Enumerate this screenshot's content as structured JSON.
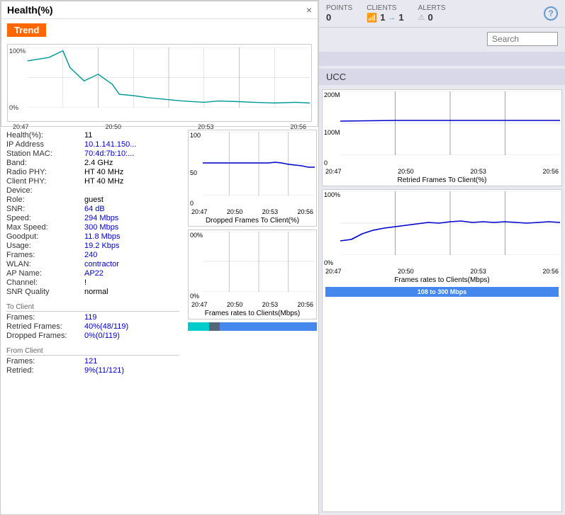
{
  "healthCard": {
    "title": "Health(%)",
    "trendLabel": "Trend",
    "closeBtn": "×",
    "chartYMax": "100%",
    "chartYMin": "0%",
    "chartXLabels": [
      "20:47",
      "20:50",
      "20:53",
      "20:56"
    ]
  },
  "info": {
    "health_label": "Health(%):",
    "health_value": "11",
    "ip_label": "IP Address",
    "ip_value": "10.1.141.150...",
    "mac_label": "Station MAC:",
    "mac_value": "70:4d:7b:10:...",
    "band_label": "Band:",
    "band_value": "2.4 GHz",
    "radio_phy_label": "Radio PHY:",
    "radio_phy_value": "HT 40 MHz",
    "client_phy_label": "Client PHY:",
    "client_phy_value": "HT 40 MHz",
    "device_label": "Device:",
    "device_value": "",
    "role_label": "Role:",
    "role_value": "guest",
    "snr_label": "SNR:",
    "snr_value": "64 dB",
    "speed_label": "Speed:",
    "speed_value": "294 Mbps",
    "max_speed_label": "Max Speed:",
    "max_speed_value": "300 Mbps",
    "goodput_label": "Goodput:",
    "goodput_value": "11.8 Mbps",
    "usage_label": "Usage:",
    "usage_value": "19.2 Kbps",
    "frames_label": "Frames:",
    "frames_value": "240",
    "wlan_label": "WLAN:",
    "wlan_value": "contractor",
    "ap_label": "AP Name:",
    "ap_value": "AP22",
    "channel_label": "Channel:",
    "channel_value": "!",
    "snr_quality_label": "SNR Quality",
    "snr_quality_value": "normal"
  },
  "toClient": {
    "section_label": "To Client",
    "frames_label": "Frames:",
    "frames_value": "119",
    "retried_label": "Retried Frames:",
    "retried_value": "40%(48/119)",
    "dropped_label": "Dropped Frames:",
    "dropped_value": "0%(0/119)"
  },
  "fromClient": {
    "section_label": "From Client",
    "frames_label": "Frames:",
    "frames_value": "121",
    "retried_label": "Retried:",
    "retried_value": "9%(11/121)"
  },
  "topBar": {
    "points_label": "POINTS",
    "points_value": "0",
    "clients_label": "CLIENTS",
    "clients_wifi": "1",
    "clients_arrow": "1",
    "alerts_label": "ALERTS",
    "alerts_value": "0",
    "help": "?"
  },
  "search": {
    "placeholder": "Search",
    "button_label": "Search"
  },
  "ucc": {
    "label": "UCC"
  },
  "droppedFrames": {
    "title": "Dropped Frames To Client(%)",
    "yMax": "100",
    "yMid": "50",
    "yMin": "0",
    "xLabels": [
      "20:47",
      "20:50",
      "20:53",
      "20:56"
    ]
  },
  "retriedFrames": {
    "title": "Retried Frames To Client(%)",
    "yMax": "200M",
    "yMid": "100M",
    "yMin": "0",
    "xLabels": [
      "20:47",
      "20:50",
      "20:53",
      "20:56"
    ]
  },
  "framesRatesBottom": {
    "title": "Frames rates to Clients(Mbps)",
    "yMax": "00%",
    "yMin": "0%",
    "xLabels": [
      "20:47",
      "20:50",
      "20:53",
      "20:56"
    ]
  },
  "framesRatesRight": {
    "title": "Frames rates to Clients(Mbps)",
    "yMax": "100%",
    "yMin": "0%",
    "xLabels": [
      "20:47",
      "20:50",
      "20:53",
      "20:56"
    ],
    "barLabel": "108 to 300 Mbps"
  }
}
